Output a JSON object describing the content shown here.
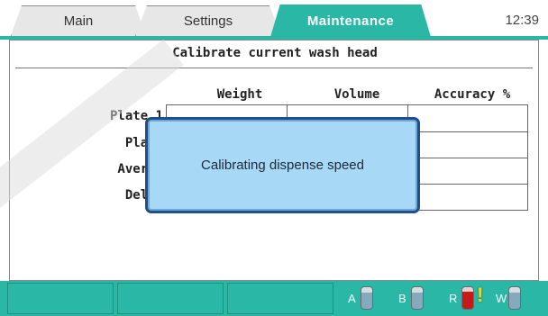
{
  "tabs": [
    {
      "label": "Main"
    },
    {
      "label": "Settings"
    },
    {
      "label": "Maintenance",
      "active": true
    }
  ],
  "clock": "12:39",
  "panel": {
    "title": "Calibrate current wash head",
    "columns": [
      "Weight",
      "Volume",
      "Accuracy %"
    ],
    "rows": [
      "Plate 1",
      "Plate",
      "Averag",
      "Delta"
    ]
  },
  "modal": {
    "message": "Calibrating dispense speed"
  },
  "bottles": [
    {
      "letter": "A",
      "icon": "bottle-icon"
    },
    {
      "letter": "B",
      "icon": "bottle-icon"
    },
    {
      "letter": "R",
      "icon": "bottle-icon",
      "warning": true
    },
    {
      "letter": "W",
      "icon": "bottle-icon"
    }
  ],
  "colors": {
    "accent": "#2ab7a6",
    "modal": "#a7d8f5",
    "modal_border": "#1f4e8a",
    "reagent_red": "#c61a1a"
  }
}
